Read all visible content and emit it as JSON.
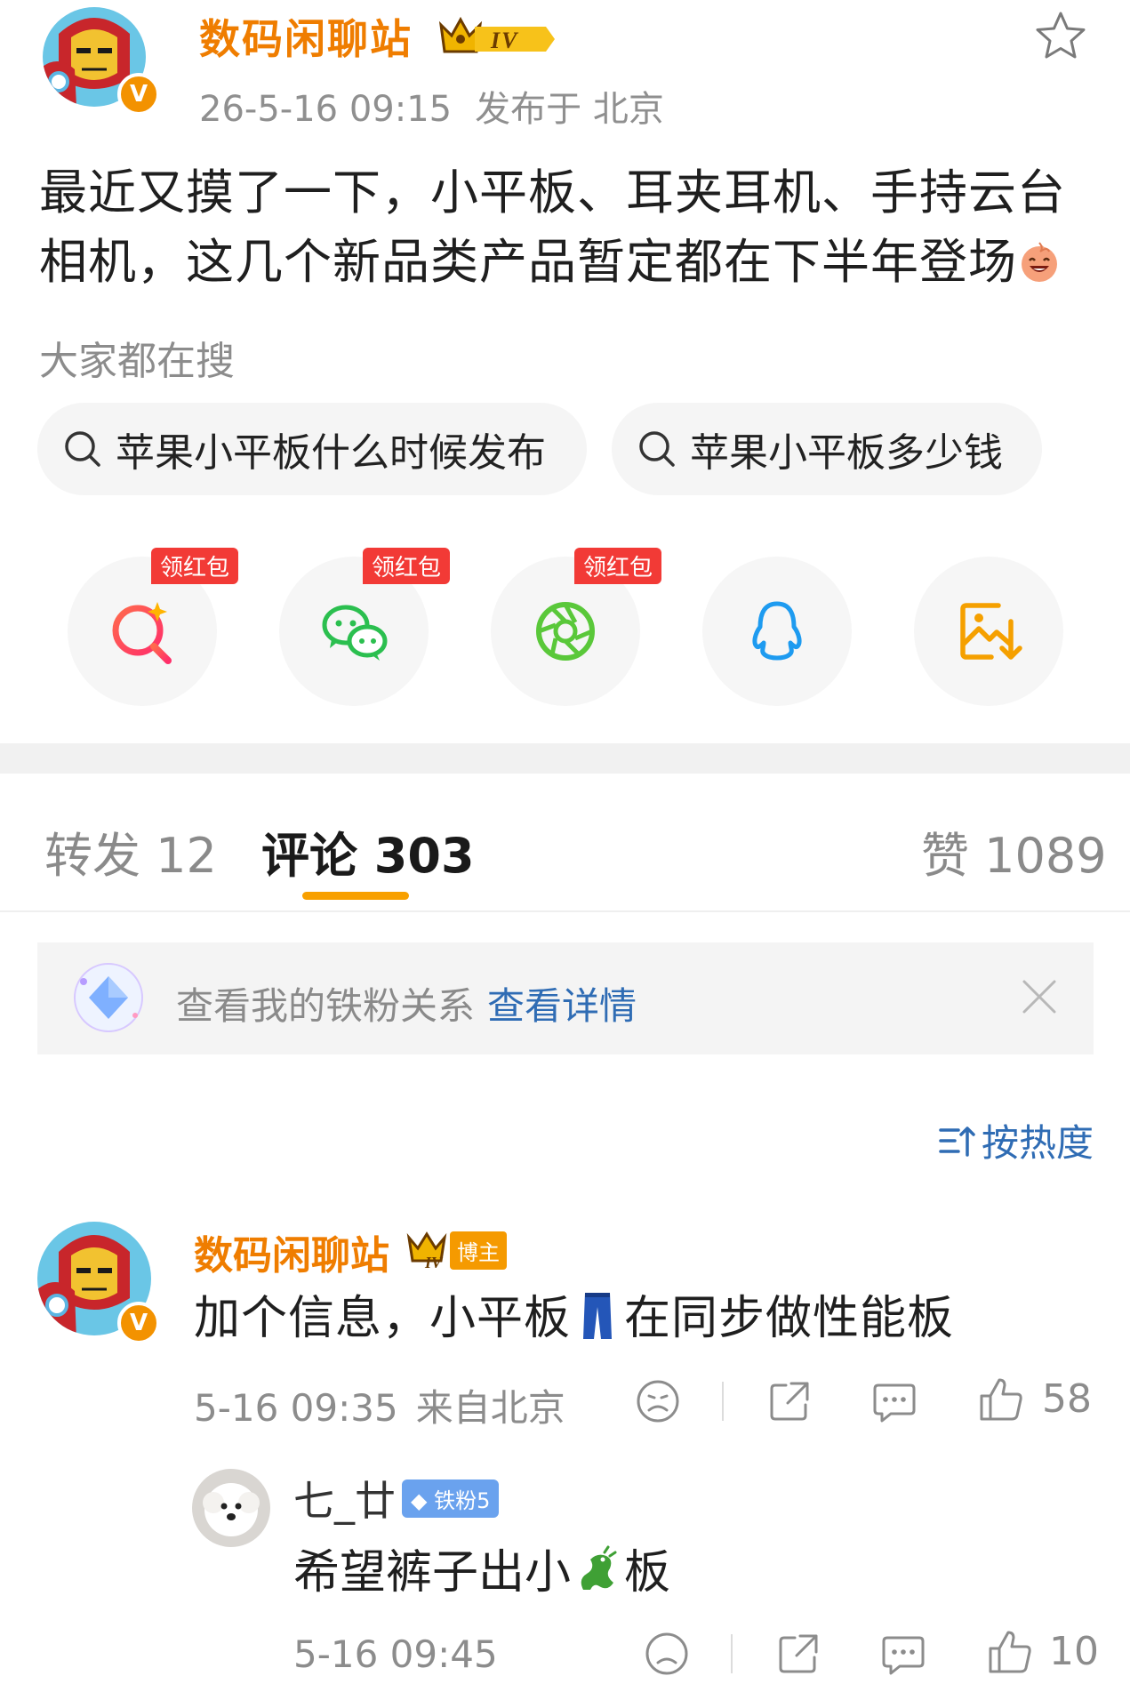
{
  "post": {
    "author": "数码闲聊站",
    "author_level": "IV",
    "verified_mark": "V",
    "date": "26-5-16 09:15",
    "location": "发布于 北京",
    "text": "最近又摸了一下，小平板、耳夹耳机、手持云台相机，这几个新品类产品暂定都在下半年登场"
  },
  "hot_search": {
    "title": "大家都在搜",
    "chips": [
      "苹果小平板什么时候发布",
      "苹果小平板多少钱"
    ]
  },
  "share": {
    "items": [
      {
        "icon": "weibo-search-share-icon",
        "tag": "领红包"
      },
      {
        "icon": "wechat-icon",
        "tag": "领红包"
      },
      {
        "icon": "moments-icon",
        "tag": "领红包"
      },
      {
        "icon": "qq-icon",
        "tag": ""
      },
      {
        "icon": "save-image-icon",
        "tag": ""
      }
    ]
  },
  "tabs": {
    "repost": "转发 12",
    "comments": "评论 303",
    "likes": "赞 1089"
  },
  "fan_banner": {
    "text": "查看我的铁粉关系",
    "link": "查看详情"
  },
  "sort": {
    "label": "按热度"
  },
  "comments": [
    {
      "author": "数码闲聊站",
      "badge_level": "IV",
      "badge_label": "博主",
      "text_before": "加个信息，小平板",
      "text_after": "在同步做性能板",
      "time": "5-16 09:35",
      "source": "来自北京",
      "likes": "58"
    }
  ],
  "reply": {
    "author": "七_廿",
    "badge": "铁粉5",
    "text_before": "希望裤子出小",
    "text_after": "板",
    "time": "5-16 09:45",
    "likes": "10"
  },
  "colors": {
    "brand_orange": "#ef7d00",
    "link_blue": "#2f6cb4",
    "red_tag": "#f23a36",
    "tab_underline": "#f8a000"
  }
}
